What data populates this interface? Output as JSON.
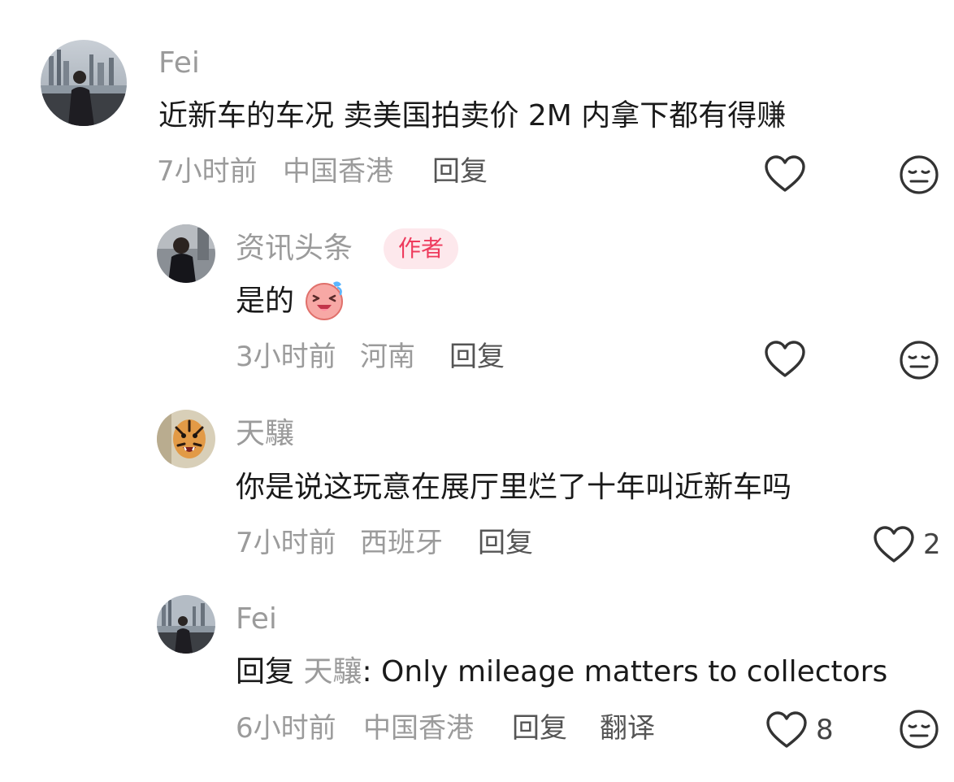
{
  "comments": [
    {
      "user": "Fei",
      "text": "近新车的车况 卖美国拍卖价 2M 内拿下都有得赚",
      "time": "7小时前",
      "location": "中国香港",
      "reply_label": "回复"
    },
    {
      "user": "资讯头条",
      "author_badge": "作者",
      "text": "是的",
      "emoji": "laughing-sticker",
      "time": "3小时前",
      "location": "河南",
      "reply_label": "回复"
    },
    {
      "user": "天驤",
      "text": "你是说这玩意在展厅里烂了十年叫近新车吗",
      "time": "7小时前",
      "location": "西班牙",
      "reply_label": "回复",
      "like_count": "2"
    },
    {
      "user": "Fei",
      "reply_prefix": "回复",
      "reply_to": "天驤",
      "text": ": Only mileage matters to collectors",
      "time": "6小时前",
      "location": "中国香港",
      "reply_label": "回复",
      "translate_label": "翻译",
      "like_count": "8"
    }
  ],
  "icons": {
    "like": "heart-outline-icon",
    "dislike": "meh-face-icon"
  },
  "colors": {
    "author_badge_bg": "#fde8ec",
    "author_badge_text": "#ee3b5d",
    "muted_text": "#9b9b9b"
  }
}
